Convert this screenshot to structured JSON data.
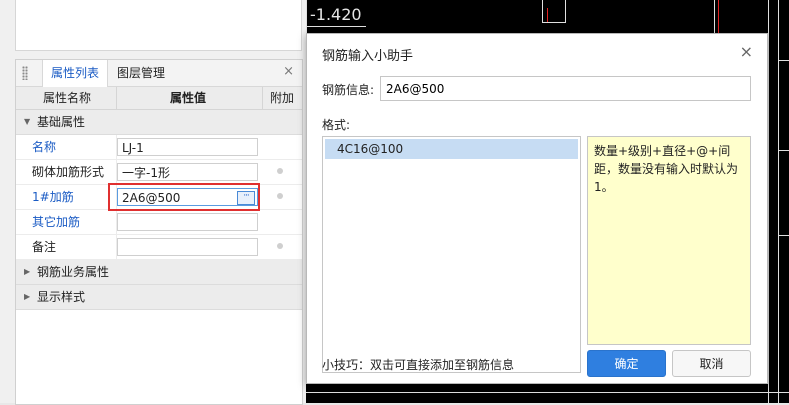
{
  "panel": {
    "tabs": [
      "属性列表",
      "图层管理"
    ],
    "close_label": "×",
    "columns": [
      "属性名称",
      "属性值",
      "附加"
    ],
    "groups": [
      "基础属性",
      "钢筋业务属性",
      "显示样式"
    ],
    "rows": [
      {
        "name": "名称",
        "value": "LJ-1"
      },
      {
        "name": "砌体加筋形式",
        "value": "一字-1形"
      },
      {
        "name": "1#加筋",
        "value": "2A6@500",
        "more": "···"
      },
      {
        "name": "其它加筋",
        "value": ""
      },
      {
        "name": "备注",
        "value": ""
      }
    ]
  },
  "cad": {
    "label": "-1.420"
  },
  "dialog": {
    "title": "钢筋输入小助手",
    "close_label": "×",
    "info_label": "钢筋信息:",
    "info_value": "2A6@500",
    "format_label": "格式:",
    "format_items": [
      "4C16@100"
    ],
    "format_desc": "数量+级别+直径+@+间距，数量没有输入时默认为1。",
    "tip": "小技巧：双击可直接添加至钢筋信息",
    "ok_label": "确定",
    "cancel_label": "取消"
  }
}
